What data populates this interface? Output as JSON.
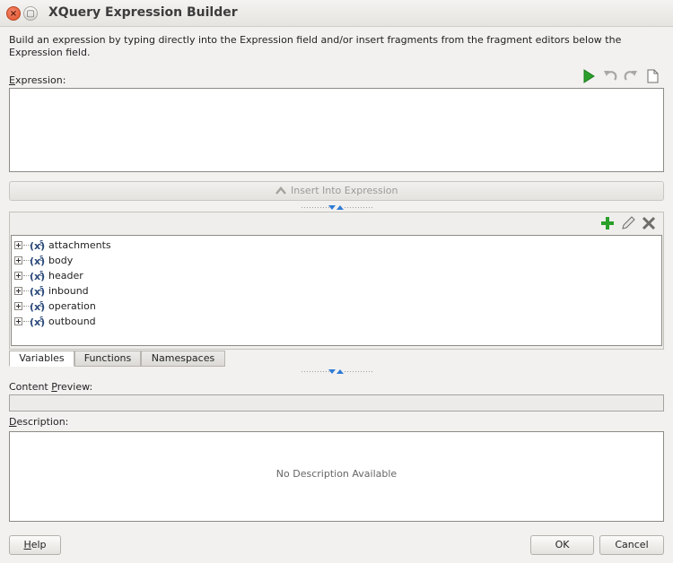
{
  "window": {
    "title": "XQuery Expression Builder"
  },
  "instructions": "Build an expression by typing directly into the Expression field and/or insert fragments from the fragment editors below the Expression field.",
  "expression": {
    "label_first": "E",
    "label_rest": "xpression:",
    "value": "",
    "toolbar": [
      "run-icon",
      "undo-icon",
      "redo-icon",
      "clear-icon"
    ]
  },
  "insert_button": {
    "label": "Insert Into Expression"
  },
  "fragment_toolbar": [
    "add-icon",
    "edit-icon",
    "delete-icon"
  ],
  "variables": [
    {
      "label": "attachments"
    },
    {
      "label": "body"
    },
    {
      "label": "header"
    },
    {
      "label": "inbound"
    },
    {
      "label": "operation"
    },
    {
      "label": "outbound"
    }
  ],
  "tabs": [
    {
      "label": "Variables",
      "active": true
    },
    {
      "label": "Functions",
      "active": false
    },
    {
      "label": "Namespaces",
      "active": false
    }
  ],
  "content_preview": {
    "label_before": "Content ",
    "label_mnemonic": "P",
    "label_after": "review:",
    "value": ""
  },
  "description": {
    "label_mnemonic": "D",
    "label_rest": "escription:",
    "text": "No Description Available"
  },
  "buttons": {
    "help_mnemonic": "H",
    "help_rest": "elp",
    "ok": "OK",
    "cancel": "Cancel"
  },
  "colors": {
    "accent_green": "#2aa02a",
    "splitter_arrow": "#2f7bd4",
    "close_button": "#e1522b"
  }
}
